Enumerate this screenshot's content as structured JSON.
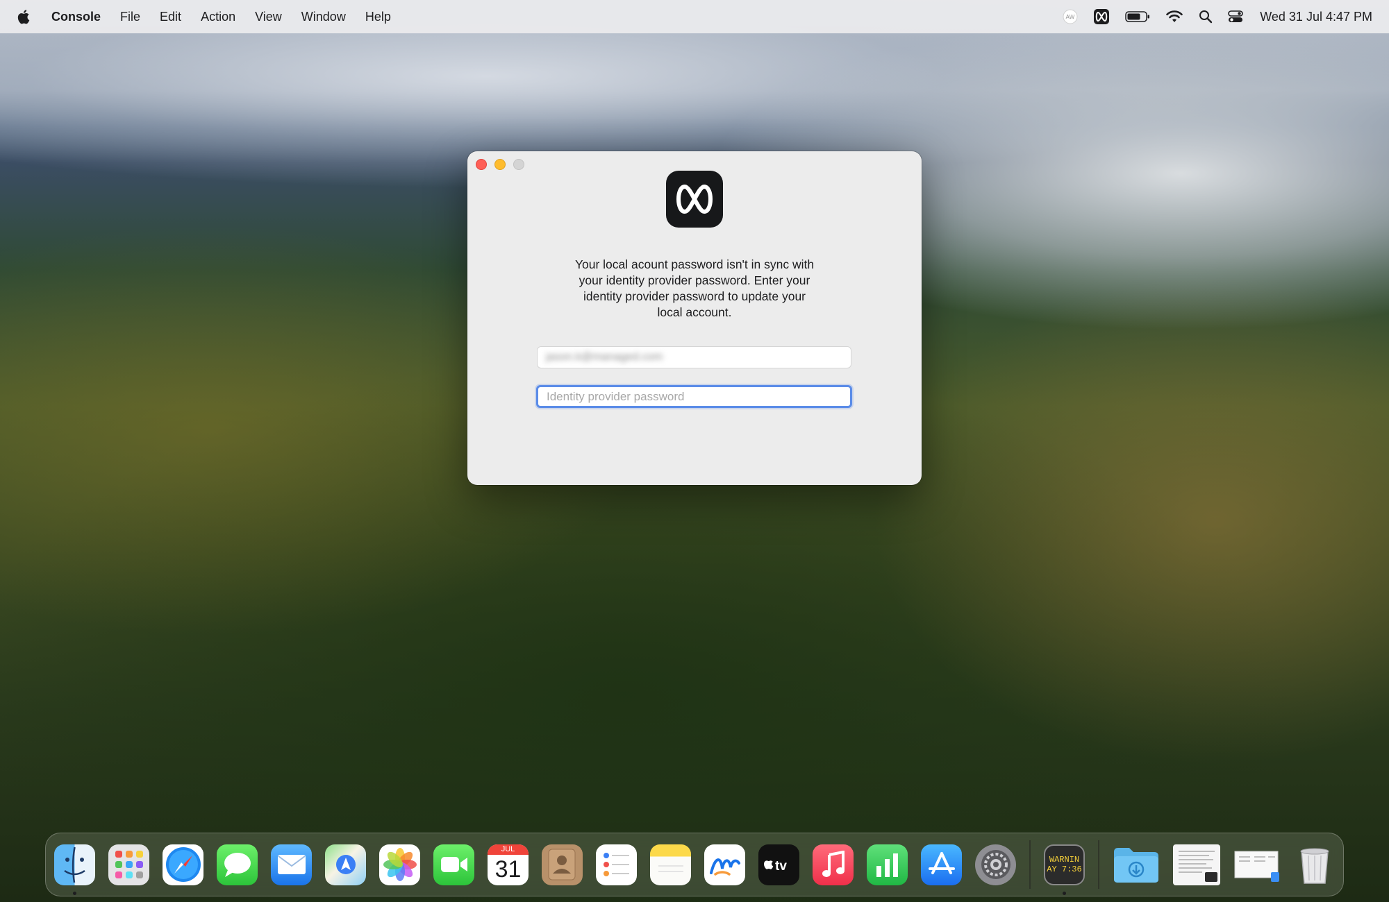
{
  "menubar": {
    "app_name": "Console",
    "menus": [
      "File",
      "Edit",
      "Action",
      "View",
      "Window",
      "Help"
    ],
    "clock": "Wed 31 Jul  4:47 PM"
  },
  "dialog": {
    "message": "Your local acount password isn't in sync with your identity provider password. Enter your identity provider password to update your local account.",
    "username_value": "jason.k@managed.com",
    "password_placeholder": "Identity provider password"
  },
  "dock": {
    "calendar_month": "JUL",
    "calendar_day": "31",
    "console_text_1": "WARNIN",
    "console_text_2": "AY 7:36",
    "apps": [
      "Finder",
      "Launchpad",
      "Safari",
      "Messages",
      "Mail",
      "Maps",
      "Photos",
      "FaceTime",
      "Calendar",
      "Contacts",
      "Reminders",
      "Notes",
      "Freeform",
      "TV",
      "Music",
      "Numbers",
      "App Store",
      "System Settings",
      "Console",
      "Downloads",
      "Recent Document",
      "Recent Window",
      "Trash"
    ]
  },
  "colors": {
    "accent": "#5b8ce8",
    "close": "#fe5f57",
    "minimize": "#febc2e",
    "zoom": "#d4d4d4"
  }
}
